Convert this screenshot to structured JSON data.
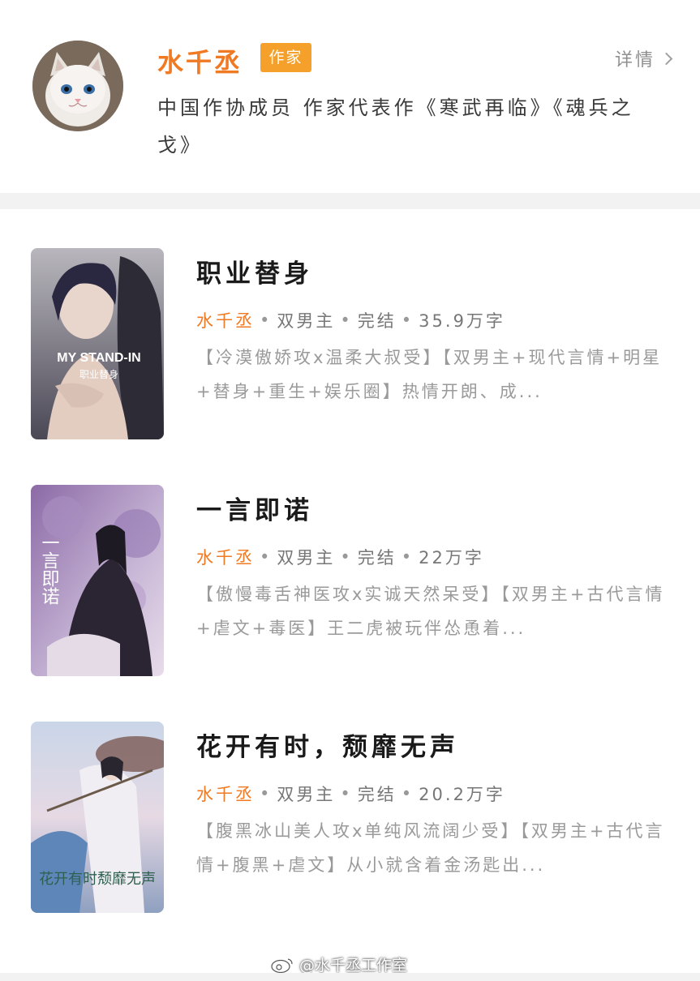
{
  "author": {
    "name": "水千丞",
    "badge": "作家",
    "detail_label": "详情",
    "description": "中国作协成员 作家代表作《寒武再临》《魂兵之戈》",
    "avatar_icon": "cat-avatar"
  },
  "books": [
    {
      "title": "职业替身",
      "author": "水千丞",
      "genre": "双男主",
      "status": "完结",
      "word_count": "35.9万字",
      "description": "【冷漠傲娇攻x温柔大叔受】【双男主+现代言情+明星+替身+重生+娱乐圈】热情开朗、成...",
      "cover_text": "MY STAND-IN",
      "cover_subtext": "职业替身"
    },
    {
      "title": "一言即诺",
      "author": "水千丞",
      "genre": "双男主",
      "status": "完结",
      "word_count": "22万字",
      "description": "【傲慢毒舌神医攻x实诚天然呆受】【双男主+古代言情+虐文+毒医】王二虎被玩伴怂恿着...",
      "cover_text": "一言即诺"
    },
    {
      "title": "花开有时，颓靡无声",
      "author": "水千丞",
      "genre": "双男主",
      "status": "完结",
      "word_count": "20.2万字",
      "description": "【腹黑冰山美人攻x单纯风流阔少受】【双男主+古代言情+腹黑+虐文】从小就含着金汤匙出...",
      "cover_text": "花开有时颓靡无声"
    }
  ],
  "meta_separator": "•",
  "watermark": "@水千丞工作室",
  "colors": {
    "accent": "#f07a23",
    "badge": "#f4a02a",
    "muted": "#9a9a9a"
  }
}
